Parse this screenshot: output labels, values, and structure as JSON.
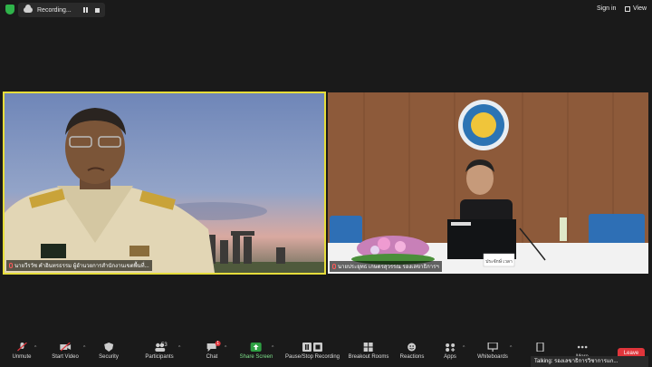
{
  "topbar": {
    "recording_label": "Recording...",
    "sign_in_label": "Sign in",
    "view_label": "View"
  },
  "participants": [
    {
      "name_tag": "นายวีรวัช คำอินทรธรรม ผู้อำนวยการสำนักงานเขตพื้นที่..."
    },
    {
      "name_tag": "นายประยุทธ เกษตรสุวรรณ รองเลขาธิการฯ"
    }
  ],
  "nameplate_text": "ประจักษ์ เวลา",
  "toolbar": {
    "unmute": "Unmute",
    "start_video": "Start Video",
    "security": "Security",
    "participants": "Participants",
    "participants_count": "53",
    "chat": "Chat",
    "chat_badge": "1",
    "share_screen": "Share Screen",
    "recording": "Pause/Stop Recording",
    "breakout": "Breakout Rooms",
    "reactions": "Reactions",
    "apps": "Apps",
    "whiteboards": "Whiteboards",
    "more": "More",
    "leave": "Leave"
  },
  "talking_text": "Talking: รองเลขาธิการวิชาการแก...",
  "colors": {
    "active_speaker_border": "#e6dd3b",
    "share_green": "#2ea043",
    "leave_red": "#e0353b",
    "background": "#1a1a1a"
  }
}
